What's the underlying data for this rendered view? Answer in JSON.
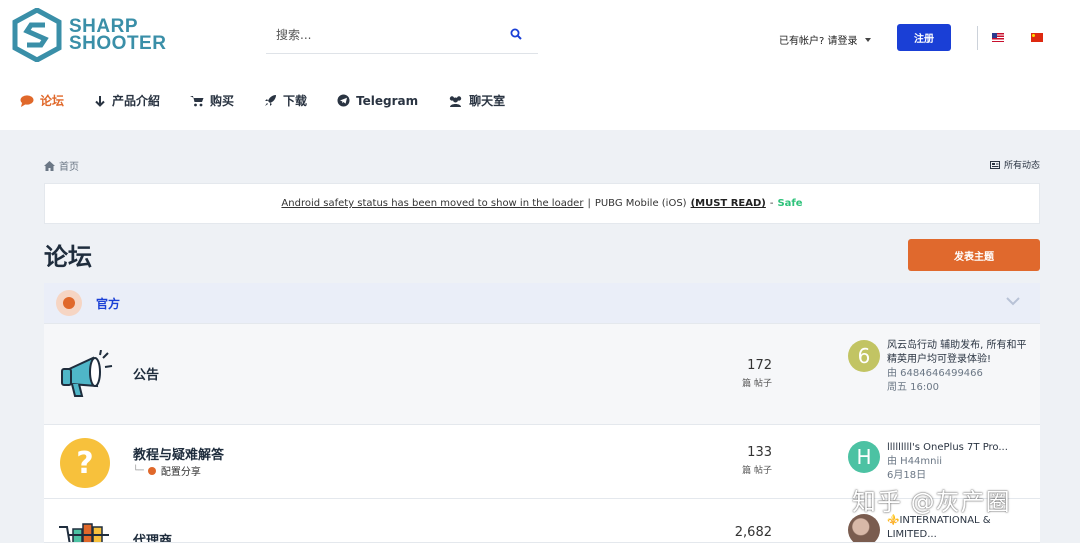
{
  "brand": {
    "line1": "SHARP",
    "line2": "SHOOTER",
    "color": "#3a8fa8"
  },
  "search": {
    "placeholder": "搜索..."
  },
  "account": {
    "login_text": "已有帐户? 请登录",
    "register_label": "注册"
  },
  "languages": [
    "en-US",
    "zh-CN"
  ],
  "nav": {
    "items": [
      {
        "label": "论坛",
        "icon": "comment-icon",
        "active": true
      },
      {
        "label": "产品介紹",
        "icon": "arrow-down-icon"
      },
      {
        "label": "购买",
        "icon": "cart-icon"
      },
      {
        "label": "下载",
        "icon": "rocket-icon"
      },
      {
        "label": "Telegram",
        "icon": "telegram-icon"
      },
      {
        "label": "聊天室",
        "icon": "chat-users-icon"
      }
    ]
  },
  "breadcrumb": {
    "home": "首页"
  },
  "activity": {
    "label": "所有动态"
  },
  "notice": {
    "link_text": "Android safety status has been moved to show in the loader",
    "separator": "|",
    "game": "PUBG Mobile (iOS)",
    "must_read": "(MUST READ)",
    "dash": "-",
    "status": "Safe"
  },
  "page_title": "论坛",
  "new_topic_label": "发表主题",
  "category": {
    "title": "官方"
  },
  "forums": [
    {
      "name": "公告",
      "posts": "172",
      "posts_label": "篇 帖子",
      "last_title": "风云岛行动 辅助发布, 所有和平精英用户均可登录体验!",
      "last_by": "由 6484646499466",
      "last_time": "周五 16:00",
      "avatar_letter": "6",
      "avatar_color": "#c2c463"
    },
    {
      "name": "教程与疑难解答",
      "subforum": "配置分享",
      "posts": "133",
      "posts_label": "篇 帖子",
      "last_title": "lllllllll's OnePlus 7T Pro...",
      "last_by": "由 H44mnii",
      "last_time": "6月18日",
      "avatar_letter": "H",
      "avatar_color": "#4cc2a3"
    },
    {
      "name": "代理商",
      "posts": "2,682",
      "last_title": "⚜️INTERNATIONAL & LIMITED..."
    }
  ],
  "watermark": "知乎 @灰产圈"
}
